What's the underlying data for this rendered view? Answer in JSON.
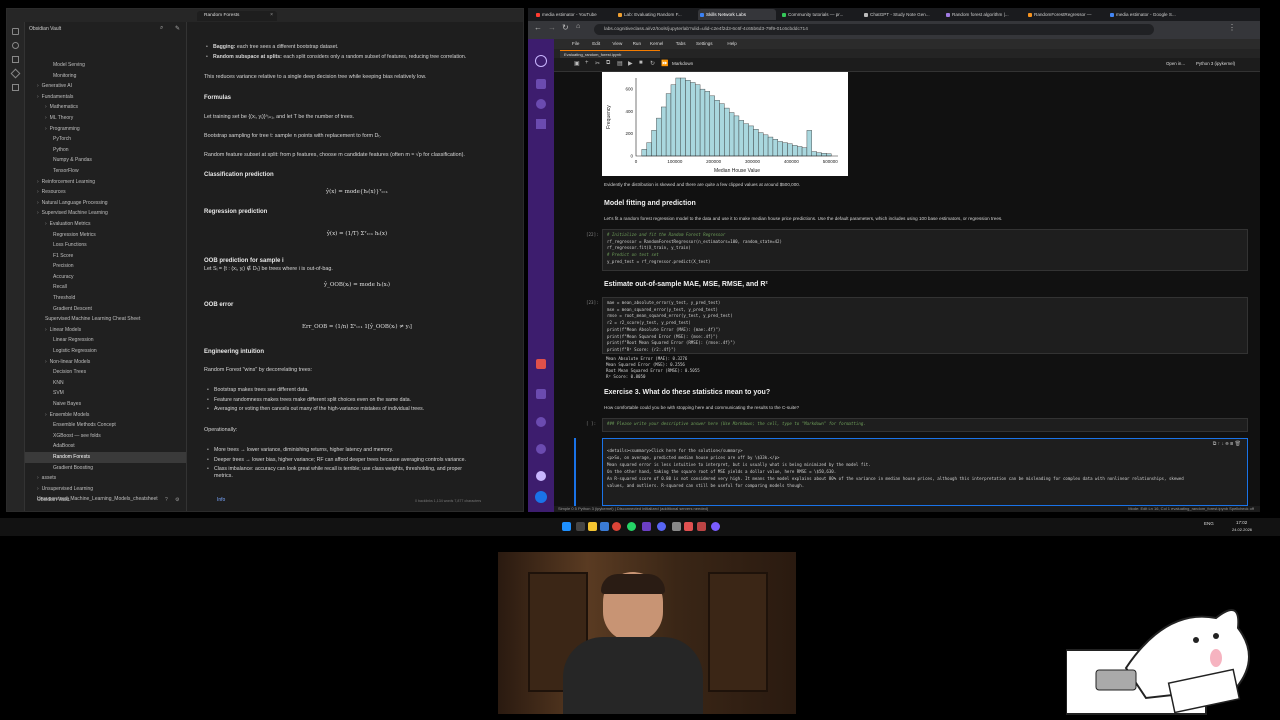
{
  "obsidian": {
    "tab_title": "Random Forests",
    "vault_name": "Obsidian Vault",
    "footer_status": "Info",
    "status_right": "0 backlinks  1,134 words  7,877 characters",
    "tree": [
      {
        "label": "Model Serving",
        "depth": 3,
        "folder": false
      },
      {
        "label": "Monitoring",
        "depth": 3,
        "folder": false
      },
      {
        "label": "Generative AI",
        "depth": 1,
        "folder": true
      },
      {
        "label": "Fundamentals",
        "depth": 1,
        "folder": true
      },
      {
        "label": "Mathematics",
        "depth": 2,
        "folder": true
      },
      {
        "label": "ML Theory",
        "depth": 2,
        "folder": true
      },
      {
        "label": "Programming",
        "depth": 2,
        "folder": true
      },
      {
        "label": "PyTorch",
        "depth": 3,
        "folder": false
      },
      {
        "label": "Python",
        "depth": 3,
        "folder": false
      },
      {
        "label": "Numpy & Pandas",
        "depth": 3,
        "folder": false
      },
      {
        "label": "TensorFlow",
        "depth": 3,
        "folder": false
      },
      {
        "label": "Reinforcement Learning",
        "depth": 1,
        "folder": true
      },
      {
        "label": "Resources",
        "depth": 1,
        "folder": true
      },
      {
        "label": "Natural Language Processing",
        "depth": 1,
        "folder": true
      },
      {
        "label": "Supervised Machine Learning",
        "depth": 1,
        "folder": true
      },
      {
        "label": "Evaluation Metrics",
        "depth": 2,
        "folder": true
      },
      {
        "label": "Regression Metrics",
        "depth": 3,
        "folder": false
      },
      {
        "label": "Loss Functions",
        "depth": 3,
        "folder": false
      },
      {
        "label": "F1 Score",
        "depth": 3,
        "folder": false
      },
      {
        "label": "Precision",
        "depth": 3,
        "folder": false
      },
      {
        "label": "Accuracy",
        "depth": 3,
        "folder": false
      },
      {
        "label": "Recall",
        "depth": 3,
        "folder": false
      },
      {
        "label": "Threshold",
        "depth": 3,
        "folder": false
      },
      {
        "label": "Gradient Descent",
        "depth": 3,
        "folder": false
      },
      {
        "label": "Supervised Machine Learning Cheat Sheet",
        "depth": 2,
        "folder": false
      },
      {
        "label": "Linear Models",
        "depth": 2,
        "folder": true
      },
      {
        "label": "Linear Regression",
        "depth": 3,
        "folder": false
      },
      {
        "label": "Logistic Regression",
        "depth": 3,
        "folder": false
      },
      {
        "label": "Non-linear Models",
        "depth": 2,
        "folder": true
      },
      {
        "label": "Decision Trees",
        "depth": 3,
        "folder": false
      },
      {
        "label": "KNN",
        "depth": 3,
        "folder": false
      },
      {
        "label": "SVM",
        "depth": 3,
        "folder": false
      },
      {
        "label": "Naive Bayes",
        "depth": 3,
        "folder": false
      },
      {
        "label": "Ensemble Models",
        "depth": 2,
        "folder": true
      },
      {
        "label": "Ensemble Methods Concept",
        "depth": 3,
        "folder": false
      },
      {
        "label": "XGBoost — see folds",
        "depth": 3,
        "folder": false
      },
      {
        "label": "AdaBoost",
        "depth": 3,
        "folder": false
      },
      {
        "label": "Random Forests",
        "depth": 3,
        "folder": false,
        "active": true
      },
      {
        "label": "Gradient Boosting",
        "depth": 3,
        "folder": false
      },
      {
        "label": "assets",
        "depth": 1,
        "folder": true
      },
      {
        "label": "Unsupervised Learning",
        "depth": 1,
        "folder": true
      },
      {
        "label": "Unsupervised_Machine_Learning_Models_cheatsheet",
        "depth": 1,
        "folder": false
      }
    ],
    "note": {
      "bagging_bold": "Bagging:",
      "bagging_text": " each tree sees a different bootstrap dataset.",
      "subspace_bold": "Random subspace at splits:",
      "subspace_text": " each split considers only a random subset of features, reducing tree correlation.",
      "variance_line": "This reduces variance relative to a single deep decision tree while keeping bias relatively low.",
      "formulas_heading": "Formulas",
      "training_line": "Let training set be {(xᵢ, yᵢ)}ⁿᵢ₌₁, and let T be the number of trees.",
      "bootstrap_line": "Bootstrap sampling for tree t: sample n points with replacement to form Dₜ.",
      "feature_line": "Random feature subset at split: from p features, choose m candidate features (often m ≈ √p for classification).",
      "classification_heading": "Classification prediction",
      "classification_formula": "ŷ(x) = mode{hₜ(x)}ᵀₜ₌₁",
      "regression_heading": "Regression prediction",
      "regression_formula": "ŷ(x) = (1/T) Σᵀₜ₌₁ hₜ(x)",
      "oob_heading": "OOB prediction for sample i",
      "oob_line": "Let Sᵢ = {t : (xᵢ, yᵢ) ∉ Dₜ} be trees where i is out-of-bag.",
      "oob_formula": "ŷ_OOB(xᵢ) = mode hₜ(xᵢ)",
      "ooberror_heading": "OOB error",
      "ooberror_formula": "Err_OOB = (1/n) Σⁿᵢ₌₁ 1[ŷ_OOB(xᵢ) ≠ yᵢ]",
      "engineering_heading": "Engineering intuition",
      "engineering_line": "Random Forest \"wins\" by decorrelating trees:",
      "eng_items": [
        "Bootstrap makes trees see different data.",
        "Feature randomness makes trees make different split choices even on the same data.",
        "Averaging or voting then cancels out many of the high-variance mistakes of individual trees."
      ],
      "operational_heading": "Operationally:",
      "op_items": [
        "More trees → lower variance, diminishing returns, higher latency and memory.",
        "Deeper trees → lower bias, higher variance; RF can afford deeper trees because averaging controls variance.",
        "Class imbalance: accuracy can look great while recall is terrible; use class weights, thresholding, and proper",
        "metrics."
      ]
    }
  },
  "browser": {
    "tabs": [
      {
        "label": "media estimator - YouTube",
        "fav": "#ff3b30"
      },
      {
        "label": "Lab: Evaluating Random F...",
        "fav": "#f0a030"
      },
      {
        "label": "Skills Network Labs",
        "fav": "#3b82f6",
        "active": true
      },
      {
        "label": "Community tutorials — pr...",
        "fav": "#34c759"
      },
      {
        "label": "ChatGPT - Study Note Gen...",
        "fav": "#bbbbbb"
      },
      {
        "label": "Random forest algorithm |...",
        "fav": "#a07ae0"
      },
      {
        "label": "RandomForestRegressor —",
        "fav": "#f7931e"
      },
      {
        "label": "media estimator - Google S...",
        "fav": "#4285f4"
      }
    ],
    "url": "labs.cognitiveclass.ai/v2/tools/jupyterlab?ulid=ulid-c2e4f2d3-6c6f-4c65b6d3-79f9-01c6cbddc714",
    "menus": [
      "File",
      "Edit",
      "View",
      "Run",
      "Kernel",
      "Tabs",
      "Settings",
      "Help"
    ],
    "file_tab": "Evaluating_random_forest.ipynb",
    "cell_type": "Markdown",
    "kernel": "Python 3 (ipykernel)",
    "open_in": "Open in...",
    "status_left": "Simple   0   5   Python 3 (ipykernel) | Disconnected   initialized (additional servers needed)",
    "status_right": "Mode: Edit   Ln 16, Col 1   evaluating_random_forest.ipynb   Spellcheck off"
  },
  "notebook": {
    "histogram_xlabel": "Median House Value",
    "histogram_ylabel": "Frequency",
    "skewed_text": "Evidently the distribution is skewed and there are quite a few clipped values at around $500,000.",
    "fitting_heading": "Model fitting and prediction",
    "fitting_text": "Let's fit a random forest regression model to the data and use it to make median house price predictions. Use the default parameters, which includes using 100 base estimators, or regression trees.",
    "cell22_prompt": "[22]:",
    "cell22_lines": [
      {
        "text": "# Initialize and fit the Random Forest Regressor",
        "comment": true
      },
      {
        "text": "rf_regressor = RandomForestRegressor(n_estimators=100, random_state=42)",
        "comment": false
      },
      {
        "text": "rf_regressor.fit(X_train, y_train)",
        "comment": false
      },
      {
        "text": "",
        "comment": false
      },
      {
        "text": "# Predict on test set",
        "comment": true
      },
      {
        "text": "y_pred_test = rf_regressor.predict(X_test)",
        "comment": false
      }
    ],
    "estimate_heading": "Estimate out-of-sample MAE, MSE, RMSE, and R²",
    "cell23_prompt": "[23]:",
    "cell23_lines": [
      "mae = mean_absolute_error(y_test, y_pred_test)",
      "mse = mean_squared_error(y_test, y_pred_test)",
      "rmse = root_mean_squared_error(y_test, y_pred_test)",
      "r2 = r2_score(y_test, y_pred_test)",
      "print(f\"Mean Absolute Error (MAE): {mae:.4f}\")",
      "print(f\"Mean Squared Error (MSE): {mse:.4f}\")",
      "print(f\"Root Mean Squared Error (RMSE): {rmse:.4f}\")",
      "print(f\"R² Score: {r2:.4f}\")"
    ],
    "cell23_output": [
      "Mean Absolute Error (MAE): 0.3276",
      "Mean Squared Error (MSE): 0.2556",
      "Root Mean Squared Error (RMSE): 0.5055",
      "R² Score: 0.8050"
    ],
    "exercise_heading": "Exercise 3. What do these statistics mean to you?",
    "exercise_text": "How comfortable could you be with stopping here and communicating the results to the C-suite?",
    "empty_prompt": "[ ]:",
    "empty_cell_text": "### Please write your descriptive answer here (Use Markdown; the cell, type to \"Markdown\" for formatting.",
    "solution_lines": [
      "<details><summary>Click here for the solution</summary>",
      "<p>So, on average, predicted median house prices are off by \\$33k.</p>",
      "Mean squared error is less intuitive to interpret, but is usually what is being minimized by the model fit.",
      "",
      "On the other hand, taking the square root of MSE yields a dollar value, here RMSE = \\$50,630.",
      "",
      "An R-squared score of 0.80 is not considered very high. It means the model explains about 80% of the variance in median house prices, although this interpretation can be misleading for complex data with nonlinear relationships, skewed",
      "values, and outliers. R-squared can still be useful for comparing models though."
    ]
  },
  "chart_data": {
    "type": "bar",
    "xlabel": "Median House Value",
    "ylabel": "Frequency",
    "x_ticks": [
      "0",
      "100000",
      "200000",
      "300000",
      "400000",
      "500000"
    ],
    "y_ticks": [
      "0",
      "200",
      "400",
      "600"
    ],
    "xlim": [
      0,
      520000
    ],
    "ylim": [
      0,
      700
    ],
    "bins_start": 15000,
    "bin_width": 12500,
    "values": [
      60,
      120,
      230,
      340,
      440,
      560,
      640,
      700,
      700,
      680,
      660,
      640,
      600,
      580,
      540,
      500,
      470,
      430,
      390,
      360,
      320,
      290,
      270,
      240,
      210,
      190,
      170,
      150,
      130,
      120,
      110,
      95,
      85,
      75,
      230,
      40,
      30,
      25,
      20
    ]
  },
  "taskbar": {
    "time": "17:02",
    "date": "24.02.2026",
    "lang": "ENG"
  },
  "colors": {
    "jupyter_sidebar": "#3d1d6e",
    "bar_fill": "#a9d7de",
    "accent_blue": "#1a73e8"
  }
}
